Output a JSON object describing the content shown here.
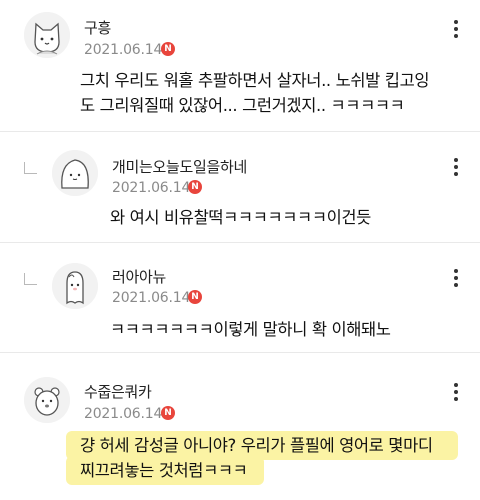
{
  "comments": [
    {
      "nickname": "구흥",
      "date": "2021.06.14",
      "badge": "N",
      "lines": [
        "그치 우리도 워홀 추팔하면서 살자너.. 노쉬발 킵고잉",
        "도 그리워질때 있잖어... 그런거겠지.. ㅋㅋㅋㅋㅋ"
      ],
      "avatar_icon": "cat-avatar-icon"
    },
    {
      "nickname": "개미는오늘도일을하네",
      "date": "2021.06.14",
      "badge": "N",
      "lines": [
        "와 여시 비유찰떡ㅋㅋㅋㅋㅋㅋㅋ이건듯"
      ],
      "avatar_icon": "blob-avatar-icon",
      "is_reply": true
    },
    {
      "nickname": "러아아뉴",
      "date": "2021.06.14",
      "badge": "N",
      "lines": [
        "ㅋㅋㅋㅋㅋㅋㅋ이렇게 말하니 확 이해돼노"
      ],
      "avatar_icon": "ghost-avatar-icon",
      "is_reply": true
    },
    {
      "nickname": "수줍은쿼카",
      "date": "2021.06.14",
      "badge": "N",
      "lines": [
        "걍 허세 감성글 아니야? 우리가 플필에 영어로 몇마디",
        "찌끄려놓는 것처럼ㅋㅋㅋ"
      ],
      "avatar_icon": "quokka-avatar-icon",
      "highlighted": true,
      "highlight_color": "#fbf3a4"
    }
  ],
  "colors": {
    "badge": "#e8453c",
    "date": "#8a8a8a",
    "divider": "#e9e9e9"
  }
}
